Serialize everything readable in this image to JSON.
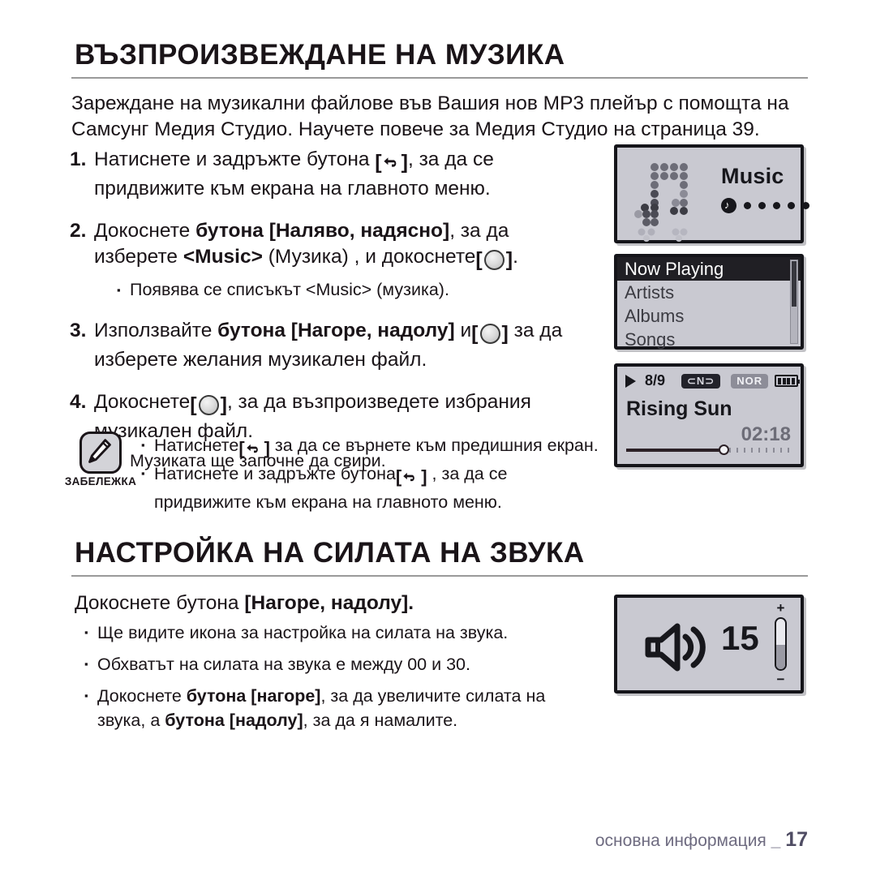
{
  "document": {
    "footer_label": "основна информация",
    "footer_separator": "_",
    "page_number": "17"
  },
  "section1": {
    "title": "ВЪЗПРОИЗВЕЖДАНЕ НА МУЗИКА",
    "intro_line1": "Зареждане на музикални файлове във Вашия нов MP3 плейър с помощта на",
    "intro_line2": "Самсунг Медия Студио. Научете повече за Медия Студио на страница 39.",
    "steps": [
      {
        "num": "1.",
        "pre": "Натиснете и задръжте бутона",
        "icon": "back-arrow-icon",
        "post": ", за да се",
        "line2": "придвижите към екрана на главното меню.",
        "bullets": []
      },
      {
        "num": "2.",
        "pre": "Докоснете",
        "bold1": "бутона [Наляво, надясно]",
        "post": ", за да",
        "line2_pre": "изберете",
        "line2_bold": "<Music>",
        "line2_mid": "(Музика) , и докоснете",
        "icon": "circle-button-icon",
        "line2_post": ".",
        "bullets": [
          "Появява се списъкът <Music> (музика)."
        ]
      },
      {
        "num": "3.",
        "pre": "Използвайте",
        "bold1": "бутона [Нагоре, надолу]",
        "mid": "и",
        "icon": "circle-button-icon",
        "post": "за да",
        "line2": "изберете желания музикален файл.",
        "bullets": []
      },
      {
        "num": "4.",
        "pre": "Докоснете",
        "icon": "circle-button-icon",
        "post": ", за да възпроизведете избрания",
        "line2": "музикален файл.",
        "bullets": [
          "Музиката ще започне да свири."
        ]
      }
    ],
    "note": {
      "icon": "note-pencil-icon",
      "label": "ЗАБЕЛЕЖКА",
      "items": [
        {
          "pre": "Натиснете",
          "icon": "back-arrow-icon",
          "post": "за да се върнете към предишния екран."
        },
        {
          "pre": "Натиснете и задръжте бутона",
          "icon": "back-arrow-icon",
          "post": ", за да се",
          "cont": "придвижите към екрана на главното меню."
        }
      ]
    }
  },
  "section2": {
    "title": "НАСТРОЙКА НА СИЛАТА НА ЗВУКА",
    "lead_pre": "Докоснете бутона",
    "lead_bold": "[Нагоре, надолу].",
    "bullets": [
      {
        "text": "Ще видите икона за настройка на силата на звука."
      },
      {
        "text": "Обхватът на силата на звука е между 00 и 30."
      },
      {
        "pre": "Докоснете",
        "bold1": "бутона [нагоре]",
        "mid": ", за да увеличите силата на",
        "line2_pre": "звука, а",
        "line2_bold": "бутона [надолу]",
        "line2_post": ", за да я намалите."
      }
    ]
  },
  "screens": {
    "music_splash": {
      "icon": "music-note-icon",
      "label": "Music",
      "indicator_dots": 5,
      "lead_dot_icon": "music-note-dot-icon"
    },
    "menu_list": {
      "items": [
        {
          "label": "Now Playing",
          "selected": true
        },
        {
          "label": "Artists",
          "selected": false
        },
        {
          "label": "Albums",
          "selected": false
        },
        {
          "label": "Songs",
          "selected": false
        }
      ],
      "scrollbar": "vertical-scrollbar"
    },
    "now_playing": {
      "play_icon": "play-icon",
      "track_count": "8/9",
      "repeat_badge": "repeat-all-icon",
      "mode_badge": "NOR",
      "battery_icon": "battery-full-icon",
      "title": "Rising Sun",
      "time": "02:18",
      "progress_percent": 58
    },
    "volume": {
      "speaker_icon": "speaker-volume-icon",
      "value": "15",
      "plus_label": "+",
      "minus_label": "−",
      "slider_level_percent": 48
    }
  },
  "colors": {
    "text": "#1a1418",
    "rule": "#9a9a9a",
    "lcd_bg": "#c9c9d1",
    "lcd_border": "#15151a",
    "footer": "#6e6b80"
  }
}
